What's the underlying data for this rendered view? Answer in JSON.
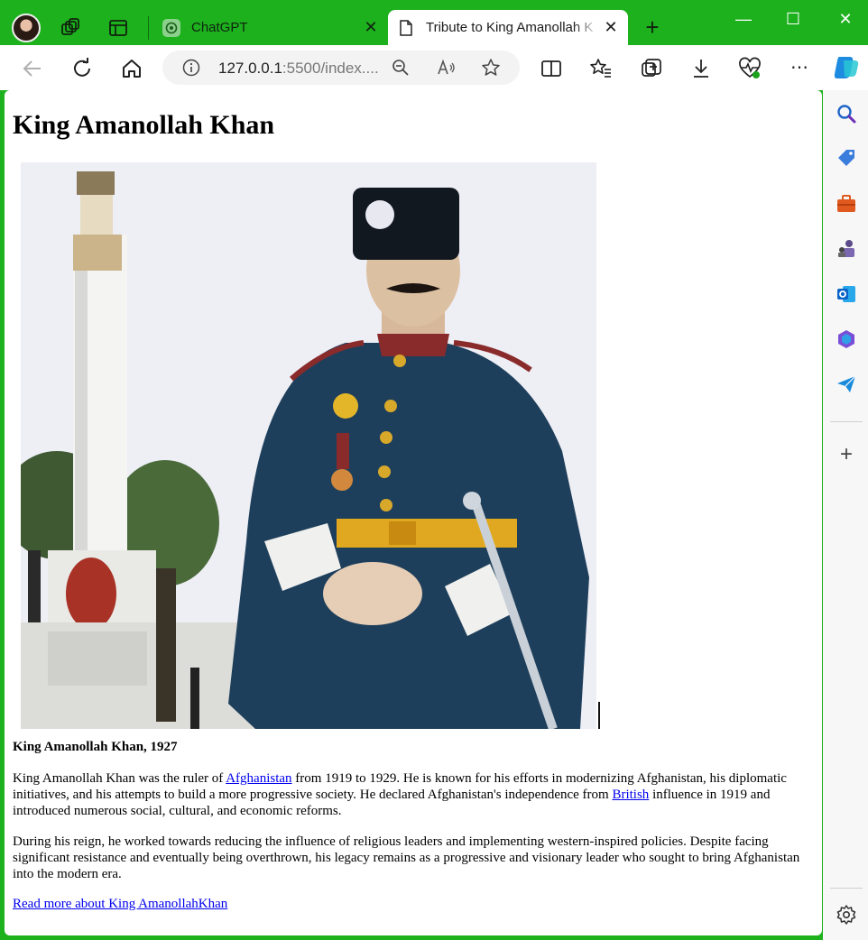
{
  "browser": {
    "tabs": [
      {
        "title": "ChatGPT",
        "active": false
      },
      {
        "title": "Tribute to King Amanollah K",
        "active": true
      }
    ],
    "url": {
      "host": "127.0.0.1",
      "rest": ":5500/index...."
    },
    "icons": {
      "back": "arrow-left-icon",
      "refresh": "refresh-icon",
      "home": "home-icon",
      "info": "info-icon",
      "zoom": "zoom-out-icon",
      "read_aloud": "read-aloud-icon",
      "favorite": "star-icon",
      "split": "split-screen-icon",
      "favorites": "favorites-icon",
      "collections": "collections-icon",
      "downloads": "download-icon",
      "performance": "heart-pulse-icon",
      "more": "more-icon",
      "copilot": "copilot-icon"
    },
    "accent": "#1db11d"
  },
  "page": {
    "heading": "King Amanollah Khan",
    "caption": "King Amanollah Khan, 1927",
    "p1": {
      "before": "King Amanollah Khan was the ruler of ",
      "link1": "Afghanistan",
      "middle": " from 1919 to 1929. He is known for his efforts in modernizing Afghanistan, his diplomatic initiatives, and his attempts to build a more progressive society. He declared Afghanistan's independence from ",
      "link2": "British",
      "after": " influence in 1919 and introduced numerous social, cultural, and economic reforms."
    },
    "p2": "During his reign, he worked towards reducing the influence of religious leaders and implementing western-inspired policies. Despite facing significant resistance and eventually being overthrown, his legacy remains as a progressive and visionary leader who sought to bring Afghanistan into the modern era.",
    "more_link": "Read more about King AmanollahKhan"
  }
}
